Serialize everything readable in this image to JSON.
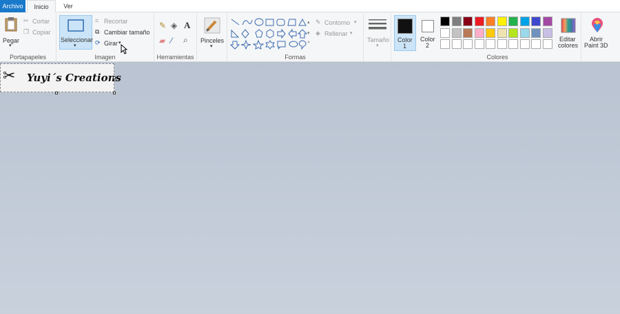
{
  "tabs": {
    "archivo": "Archivo",
    "inicio": "Inicio",
    "ver": "Ver"
  },
  "portapapeles": {
    "pegar": "Pegar",
    "cortar": "Cortar",
    "copiar": "Copiar",
    "label": "Portapapeles"
  },
  "imagen": {
    "seleccionar": "Seleccionar",
    "recortar": "Recortar",
    "cambiar_tamano": "Cambiar tamaño",
    "girar": "Girar",
    "label": "Imagen"
  },
  "herramientas": {
    "label": "Herramientas"
  },
  "pinceles": {
    "label": "Pinceles"
  },
  "formas": {
    "contorno": "Contorno",
    "rellenar": "Rellenar",
    "label": "Formas"
  },
  "tamano": {
    "label": "Tamaño"
  },
  "color1": {
    "line1": "Color",
    "line2": "1",
    "color": "#111111"
  },
  "color2": {
    "line1": "Color",
    "line2": "2",
    "color": "#ffffff"
  },
  "colores": {
    "label": "Colores",
    "row1": [
      "#000000",
      "#7f7f7f",
      "#880015",
      "#ed1c24",
      "#ff7f27",
      "#fff200",
      "#22b14c",
      "#00a2e8",
      "#3f48cc",
      "#a349a4"
    ],
    "row2": [
      "#ffffff",
      "#c3c3c3",
      "#b97a57",
      "#ffaec9",
      "#ffc90e",
      "#efe4b0",
      "#b5e61d",
      "#99d9ea",
      "#7092be",
      "#c8bfe7"
    ],
    "row3": [
      "#ffffff",
      "#ffffff",
      "#ffffff",
      "#ffffff",
      "#ffffff",
      "#ffffff",
      "#ffffff",
      "#ffffff",
      "#ffffff",
      "#ffffff"
    ]
  },
  "editar_colores": {
    "line1": "Editar",
    "line2": "colores"
  },
  "paint3d": {
    "line1": "Abrir",
    "line2": "Paint 3D"
  },
  "canvas": {
    "image_text": "Yuyi´s Creations"
  }
}
